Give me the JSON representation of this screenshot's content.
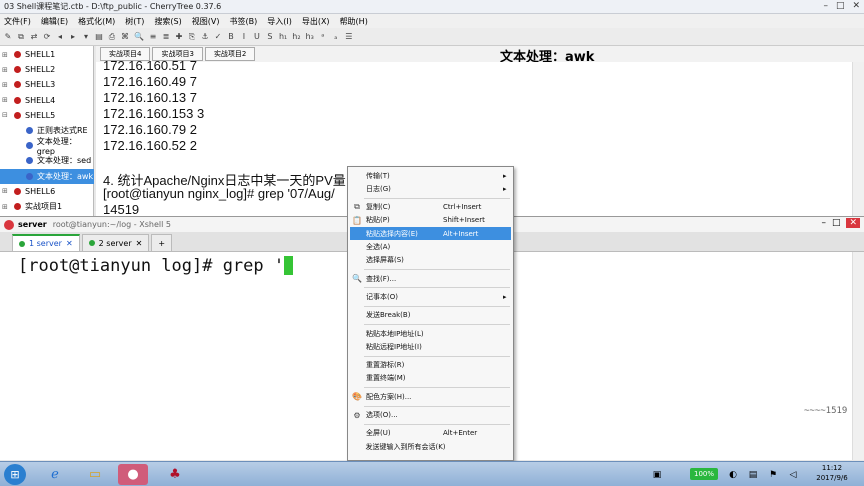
{
  "cherrytree": {
    "window_title": "03 Shell课程笔记.ctb - D:\\ftp_public - CherryTree 0.37.6",
    "menu": [
      "文件(F)",
      "编辑(E)",
      "格式化(M)",
      "树(T)",
      "搜索(S)",
      "视图(V)",
      "书签(B)",
      "导入(I)",
      "导出(X)",
      "帮助(H)"
    ],
    "toolbar_glyphs": [
      "✎",
      "⧉",
      "⇄",
      "⟳",
      "◂",
      "▸",
      "▾",
      "▤",
      "⎙",
      "⌘",
      "🔍",
      "≡",
      "≣",
      "✚",
      "⎘",
      "⚓",
      "✓",
      "B",
      "I",
      "U",
      "S",
      "h₁",
      "h₂",
      "h₃",
      "ᵃ",
      "ₐ",
      "☰"
    ],
    "tree": [
      {
        "label": "SHELL1",
        "expander": "⊞",
        "color": "red",
        "selected": false
      },
      {
        "label": "SHELL2",
        "expander": "⊞",
        "color": "red",
        "selected": false
      },
      {
        "label": "SHELL3",
        "expander": "⊞",
        "color": "red",
        "selected": false
      },
      {
        "label": "SHELL4",
        "expander": "⊞",
        "color": "red",
        "selected": false
      },
      {
        "label": "SHELL5",
        "expander": "⊟",
        "color": "red",
        "selected": false
      },
      {
        "label": "正则表达式RE",
        "expander": "",
        "color": "blue",
        "selected": false
      },
      {
        "label": "文本处理：grep",
        "expander": "",
        "color": "blue",
        "selected": false
      },
      {
        "label": "文本处理：sed",
        "expander": "",
        "color": "blue",
        "selected": false
      },
      {
        "label": "文本处理：awk",
        "expander": "",
        "color": "blue",
        "selected": true
      },
      {
        "label": "SHELL6",
        "expander": "⊞",
        "color": "red",
        "selected": false
      },
      {
        "label": "实战项目1",
        "expander": "⊞",
        "color": "red",
        "selected": false
      }
    ],
    "tabs": [
      "实战项目4",
      "实战项目3",
      "实战项目2"
    ],
    "heading": "文本处理：awk",
    "lines": [
      "172.16.160.51 7",
      "172.16.160.49 7",
      "172.16.160.13 7",
      "172.16.160.153 3",
      "172.16.160.79 2",
      "172.16.160.52 2",
      "",
      "4. 统计Apache/Nginx日志中某一天的PV量",
      "[root@tianyun nginx_log]# grep '07/Aug/",
      "14519"
    ]
  },
  "xshell": {
    "session": "server",
    "window_title": "root@tianyun:~/log - Xshell 5",
    "tabs": [
      {
        "label": "1 server",
        "active": true
      },
      {
        "label": "2 server",
        "active": false
      }
    ],
    "add_tab": "+",
    "prompt": "[root@tianyun log]# grep '",
    "cursor_char": "ᶦ",
    "counter": "~~~~1519"
  },
  "context_menu": {
    "items": [
      {
        "label": "传输(T)",
        "shortcut": "",
        "submenu": true,
        "icon": ""
      },
      {
        "label": "日志(G)",
        "shortcut": "",
        "submenu": true,
        "icon": ""
      },
      {
        "sep": true
      },
      {
        "label": "复制(C)",
        "shortcut": "Ctrl+Insert",
        "submenu": false,
        "icon": "⧉"
      },
      {
        "label": "粘贴(P)",
        "shortcut": "Shift+Insert",
        "submenu": false,
        "icon": "📋"
      },
      {
        "label": "粘贴选择内容(E)",
        "shortcut": "Alt+Insert",
        "submenu": false,
        "icon": "",
        "highlighted": true
      },
      {
        "label": "全选(A)",
        "shortcut": "",
        "submenu": false,
        "icon": ""
      },
      {
        "label": "选择屏幕(S)",
        "shortcut": "",
        "submenu": false,
        "icon": ""
      },
      {
        "sep": true
      },
      {
        "label": "查找(F)...",
        "shortcut": "",
        "submenu": false,
        "icon": "🔍"
      },
      {
        "sep": true
      },
      {
        "label": "记事本(O)",
        "shortcut": "",
        "submenu": true,
        "icon": ""
      },
      {
        "sep": true
      },
      {
        "label": "发送Break(B)",
        "shortcut": "",
        "submenu": false,
        "icon": ""
      },
      {
        "sep": true
      },
      {
        "label": "粘贴本地IP地址(L)",
        "shortcut": "",
        "submenu": false,
        "icon": ""
      },
      {
        "label": "粘贴远程IP地址(I)",
        "shortcut": "",
        "submenu": false,
        "icon": ""
      },
      {
        "sep": true
      },
      {
        "label": "重置游标(R)",
        "shortcut": "",
        "submenu": false,
        "icon": ""
      },
      {
        "label": "重置终端(M)",
        "shortcut": "",
        "submenu": false,
        "icon": ""
      },
      {
        "sep": true
      },
      {
        "label": "配色方案(H)...",
        "shortcut": "",
        "submenu": false,
        "icon": "🎨"
      },
      {
        "sep": true
      },
      {
        "label": "选项(O)...",
        "shortcut": "",
        "submenu": false,
        "icon": "⚙"
      },
      {
        "sep": true
      },
      {
        "label": "全屏(U)",
        "shortcut": "Alt+Enter",
        "submenu": false,
        "icon": ""
      },
      {
        "label": "发送键输入到所有会话(K)",
        "shortcut": "",
        "submenu": false,
        "icon": ""
      }
    ]
  },
  "taskbar": {
    "battery": "100%",
    "time": "11:12",
    "date": "2017/9/6"
  },
  "colors": {
    "selection": "#3d8fe0",
    "cursor": "#35c435",
    "tree_bullet": "#c21e1e",
    "tree_bullet_child": "#3a64c8"
  }
}
